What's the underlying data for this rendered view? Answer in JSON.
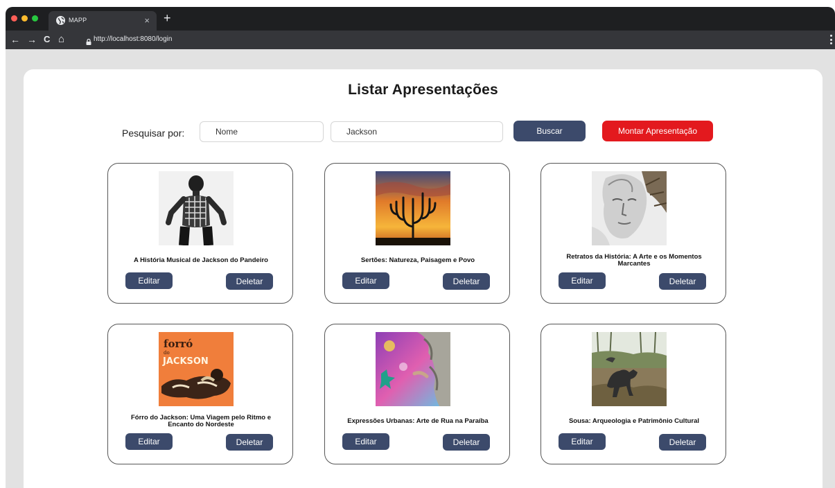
{
  "browser": {
    "tab_title": "MAPP",
    "tab_close": "×",
    "new_tab": "+",
    "url": "http://localhost:8080/login",
    "nav": {
      "back": "←",
      "forward": "→",
      "reload": "C",
      "home": "⌂"
    },
    "dot_colors": [
      "#ff5f57",
      "#febc2e",
      "#28c840"
    ]
  },
  "page": {
    "title": "Listar Apresentações",
    "search_label": "Pesquisar por:",
    "field_value": "Nome",
    "query_value": "Jackson",
    "search_button": "Buscar",
    "create_button": "Montar Apresentação"
  },
  "colors": {
    "primary_button": "#3c4a6b",
    "accent_button": "#e3191e"
  },
  "cards": [
    {
      "title": "A História Musical de Jackson do Pandeiro",
      "edit": "Editar",
      "delete": "Deletar"
    },
    {
      "title": "Sertões: Natureza, Paisagem e Povo",
      "edit": "Editar",
      "delete": "Deletar"
    },
    {
      "title": "Retratos da História: A Arte e os Momentos Marcantes",
      "edit": "Editar",
      "delete": "Deletar"
    },
    {
      "title": "Fórro do Jackson: Uma Viagem pelo Ritmo e Encanto do Nordeste",
      "edit": "Editar",
      "delete": "Deletar",
      "image_text": [
        "forró",
        "do",
        "JACKSON"
      ]
    },
    {
      "title": "Expressões Urbanas: Arte de Rua na Paraíba",
      "edit": "Editar",
      "delete": "Deletar"
    },
    {
      "title": "Sousa: Arqueologia e Patrimônio Cultural",
      "edit": "Editar",
      "delete": "Deletar"
    }
  ]
}
